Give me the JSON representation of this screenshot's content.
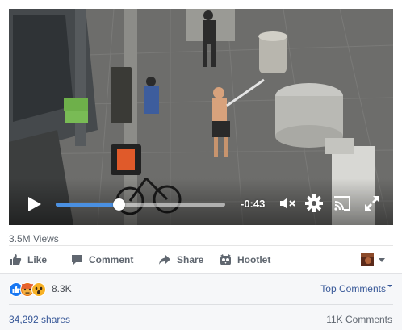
{
  "video": {
    "time_remaining": "-0:43",
    "progress": 0.37,
    "icons": [
      "play-icon",
      "mute-icon",
      "gear-icon",
      "cast-icon",
      "fullscreen-icon"
    ],
    "accent_color": "#4a90e2"
  },
  "meta": {
    "views": "3.5M Views"
  },
  "actions": {
    "like": "Like",
    "comment": "Comment",
    "share": "Share",
    "hootlet": "Hootlet"
  },
  "reactions": {
    "count": "8.3K",
    "types": [
      "like",
      "angry",
      "wow"
    ],
    "top_comments": "Top Comments",
    "shares": "34,292 shares",
    "comments": "11K Comments"
  },
  "colors": {
    "link": "#385898",
    "muted": "#606770",
    "like_blue": "#1877f2"
  }
}
